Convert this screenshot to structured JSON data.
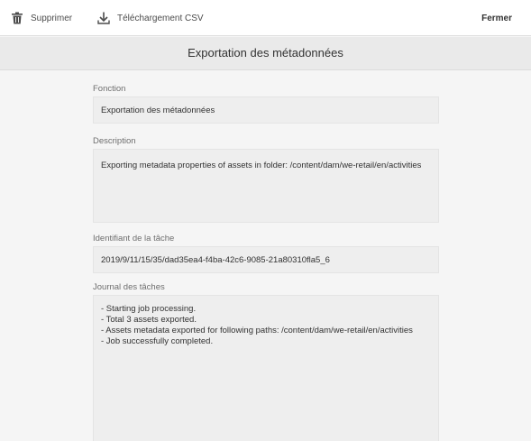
{
  "toolbar": {
    "delete_label": "Supprimer",
    "download_label": "Téléchargement CSV",
    "close_label": "Fermer"
  },
  "header": {
    "title": "Exportation des métadonnées"
  },
  "form": {
    "function": {
      "label": "Fonction",
      "value": "Exportation des métadonnées"
    },
    "description": {
      "label": "Description",
      "value": "Exporting metadata properties of assets in folder: /content/dam/we-retail/en/activities"
    },
    "job_id": {
      "label": "Identifiant de la tâche",
      "value": "2019/9/11/15/35/dad35ea4-f4ba-42c6-9085-21a80310fla5_6"
    },
    "job_log": {
      "label": "Journal des tâches",
      "lines": [
        "- Starting job processing.",
        "- Total 3 assets exported.",
        "- Assets metadata exported for following paths: /content/dam/we-retail/en/activities",
        "- Job successfully completed."
      ]
    }
  },
  "icons": {
    "delete": "trash-icon",
    "download": "download-icon"
  },
  "colors": {
    "toolbar_bg": "#ffffff",
    "title_bar_bg": "#eaeaea",
    "page_bg": "#f5f5f5",
    "field_bg": "#eeeeee",
    "text": "#4b4b4b"
  }
}
